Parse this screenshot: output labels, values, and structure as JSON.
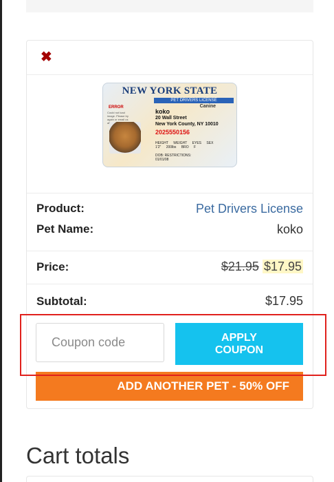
{
  "cart_item": {
    "remove_icon": "close-icon",
    "license_card": {
      "title": "NEW YORK STATE",
      "band": "PET DRIVERS LICENSE",
      "species": "Canine",
      "error": "ERROR",
      "error_note": "Could not load image. Please try again or email us after submission.",
      "pet_name": "koko",
      "address_line1": "20 Wall Street",
      "address_line2": "New York County, NY 10010",
      "number": "2025550156",
      "height_label": "HEIGHT",
      "height": "1'2\"",
      "weight_label": "WEIGHT",
      "weight": "200lbs",
      "eyes_label": "EYES",
      "eyes": "BRO",
      "sex_label": "SEX",
      "sex": "F",
      "dob_label": "DOB:",
      "dob": "01/01/08",
      "restrictions_label": "RESTRICTIONS:",
      "accent_color": "#1b3e7a"
    },
    "product_label": "Product:",
    "product_value": "Pet Drivers License",
    "pet_name_label": "Pet Name:",
    "pet_name_value": "koko",
    "price_label": "Price:",
    "price_old": "$21.95",
    "price_new": "$17.95",
    "subtotal_label": "Subtotal:",
    "subtotal_value": "$17.95"
  },
  "coupon": {
    "placeholder": "Coupon code",
    "apply_label_line1": "APPLY",
    "apply_label_line2": "COUPON",
    "apply_color": "#15c2ee"
  },
  "add_pet": {
    "label": "ADD ANOTHER PET - 50% OFF",
    "color": "#f47a1f"
  },
  "highlight_color": "#e0201c",
  "cart_totals": {
    "title": "Cart totals"
  }
}
